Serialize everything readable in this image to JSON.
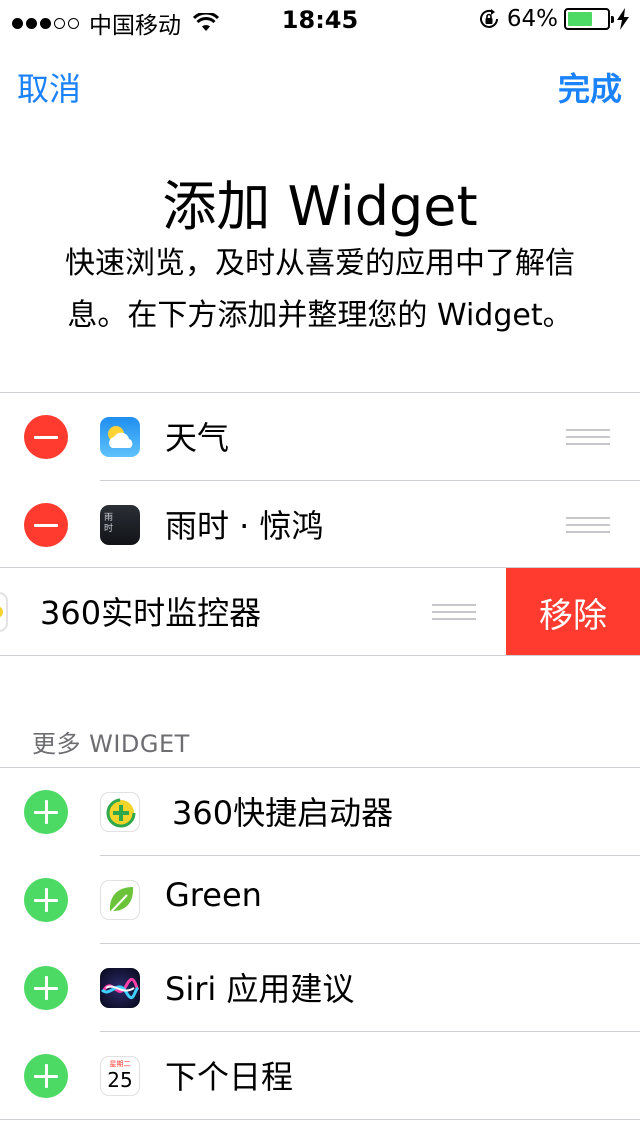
{
  "status_bar": {
    "carrier": "中国移动",
    "time": "18:45",
    "battery_percent": "64%",
    "battery_level": 0.64,
    "signal_strength": 3,
    "signal_total": 5,
    "battery_color": "#4cd964"
  },
  "nav": {
    "cancel_label": "取消",
    "done_label": "完成",
    "accent_color": "#1a82fb"
  },
  "header": {
    "title": "添加 Widget",
    "description": "快速浏览，及时从喜爱的应用中了解信息。在下方添加并整理您的 Widget。"
  },
  "active_widgets": [
    {
      "label": "天气",
      "icon": "weather-icon"
    },
    {
      "label": "雨时 · 惊鸿",
      "icon": "yushi-app-icon"
    }
  ],
  "swiped_widget": {
    "label": "360实时监控器",
    "action_label": "移除",
    "icon": "360-monitor-icon"
  },
  "more_section": {
    "header": "更多 WIDGET",
    "items": [
      {
        "label": "360快捷启动器",
        "icon": "360-launcher-icon"
      },
      {
        "label": "Green",
        "icon": "green-leaf-icon"
      },
      {
        "label": "Siri 应用建议",
        "icon": "siri-icon"
      },
      {
        "label": "下个日程",
        "icon": "calendar-icon"
      }
    ]
  },
  "calendar_icon": {
    "weekday": "星期二",
    "day": "25"
  },
  "yushi_icon": {
    "text": "雨时"
  },
  "colors": {
    "remove": "#ff3b30",
    "add": "#4cd964",
    "separator": "#d0d0d4"
  }
}
